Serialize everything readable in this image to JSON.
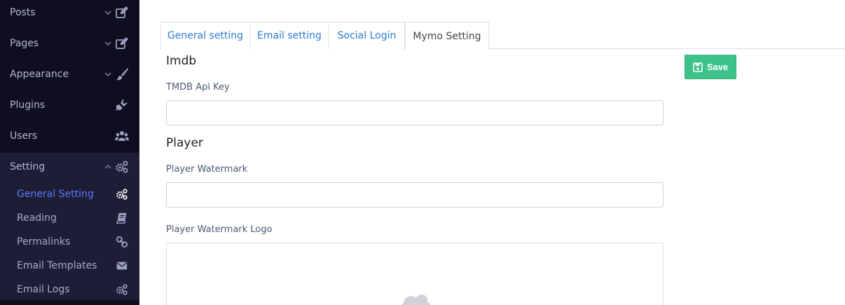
{
  "sidebar": {
    "items": [
      {
        "label": "Posts",
        "icon": "edit-icon"
      },
      {
        "label": "Pages",
        "icon": "edit-icon"
      },
      {
        "label": "Appearance",
        "icon": "paint-brush-icon"
      },
      {
        "label": "Plugins",
        "icon": "plug-icon"
      },
      {
        "label": "Users",
        "icon": "users-icon"
      },
      {
        "label": "Setting",
        "icon": "cogs-icon"
      }
    ],
    "sub_items": [
      {
        "label": "General Setting",
        "icon": "cogs-icon",
        "active": true
      },
      {
        "label": "Reading",
        "icon": "book-icon"
      },
      {
        "label": "Permalinks",
        "icon": "link-icon"
      },
      {
        "label": "Email Templates",
        "icon": "envelope-icon"
      },
      {
        "label": "Email Logs",
        "icon": "cogs-icon"
      }
    ]
  },
  "tabs": [
    {
      "label": "General setting"
    },
    {
      "label": "Email setting"
    },
    {
      "label": "Social Login"
    },
    {
      "label": "Mymo Setting",
      "active": true
    }
  ],
  "form": {
    "imdb_title": "Imdb",
    "tmdb_label": "TMDB Api Key",
    "tmdb_value": "",
    "player_title": "Player",
    "watermark_label": "Player Watermark",
    "watermark_value": "",
    "watermark_logo_label": "Player Watermark Logo"
  },
  "save_button": {
    "label": "Save"
  },
  "colors": {
    "sidebar_bg": "#0e0e20",
    "active_link": "#5b7cff",
    "tab_link": "#2a7ad6",
    "save_bg": "#3ec28b"
  }
}
